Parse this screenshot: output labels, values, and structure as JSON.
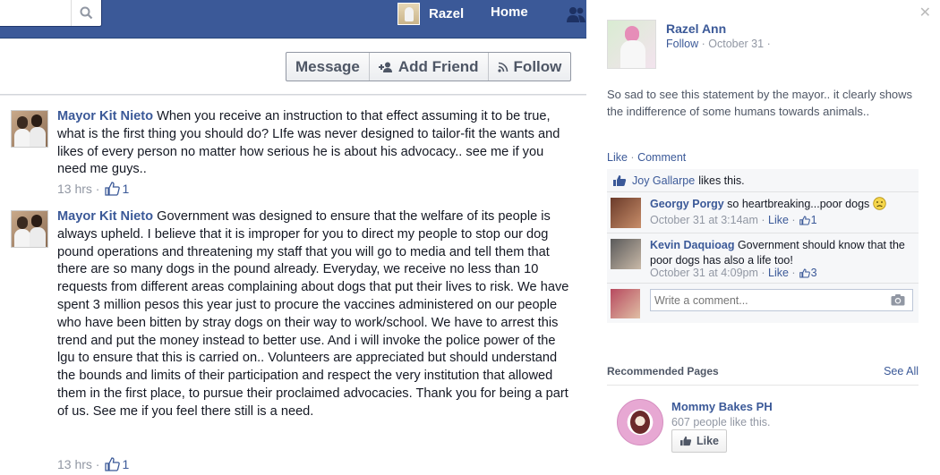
{
  "topbar": {
    "user_name": "Razel",
    "home_label": "Home"
  },
  "actions": {
    "message_label": "Message",
    "add_friend_label": "Add Friend",
    "follow_label": "Follow"
  },
  "comments": [
    {
      "author": "Mayor Kit Nieto",
      "text": "When you receive an instruction to that effect assuming it to be true, what is the first thing you should do? LIfe was never designed to tailor-fit the wants and likes of every person no matter how serious he is about his advocacy.. see me if you need me guys..",
      "time": "13 hrs",
      "likes": "1"
    },
    {
      "author": "Mayor Kit Nieto",
      "text": "Government was designed to ensure that the welfare of its people is always upheld. I believe that it is improper for you to direct my people to stop our dog pound operations and threatening my staff that you will go to media and tell them that there are so many dogs in the pound already. Everyday, we receive no less than 10 requests from different areas complaining about dogs that put their lives to risk. We have spent 3 million pesos this year just to procure the vaccines administered on our people who have been bitten by stray dogs on their way to work/school. We have to arrest this trend and put the money instead to better use. And i will invoke the police power of the lgu to ensure that this is carried on.. Volunteers are appreciated but should understand the bounds and limits of their participation and respect the very institution that allowed them in the first place, to pursue their proclaimed advocacies. Thank you for being a part of us. See me if you feel there still is a need.",
      "time": "13 hrs",
      "likes": "1"
    }
  ],
  "post": {
    "author": "Razel Ann",
    "follow": "Follow",
    "date": "October 31",
    "text": "So sad to see this statement by the mayor.. it clearly shows the indifference of some humans towards animals..",
    "like_label": "Like",
    "comment_label": "Comment",
    "liker": "Joy Gallarpe",
    "likes_suffix": "likes this.",
    "replies": [
      {
        "author": "Georgy Porgy",
        "text": "so heartbreaking...poor dogs",
        "time": "October 31 at 3:14am",
        "like_label": "Like",
        "likes": "1"
      },
      {
        "author": "Kevin Daquioag",
        "text": "Government should know that the poor dogs has also a life too!",
        "time": "October 31 at 4:09pm",
        "like_label": "Like",
        "likes": "3"
      }
    ],
    "write_placeholder": "Write a comment..."
  },
  "recommended": {
    "header": "Recommended Pages",
    "see_all": "See All",
    "page_name": "Mommy Bakes PH",
    "page_likes": "607 people like this.",
    "like_button": "Like"
  },
  "colors": {
    "brand": "#3b5998",
    "meta": "#9197a3"
  }
}
